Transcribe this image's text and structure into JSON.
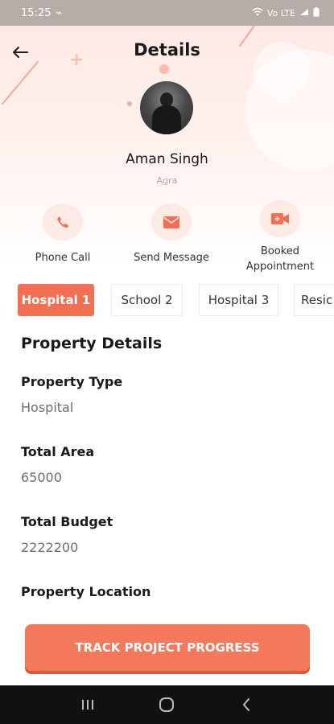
{
  "status_bar": {
    "time": "15:25",
    "signal": "Vo LTE",
    "battery": "▮"
  },
  "header": {
    "title": "Details"
  },
  "profile": {
    "name": "Aman Singh",
    "city": "Agra"
  },
  "actions": [
    {
      "label": "Phone Call",
      "icon": "phone-icon"
    },
    {
      "label": "Send Message",
      "icon": "mail-icon"
    },
    {
      "label": "Booked Appointment",
      "icon": "video-call-icon"
    }
  ],
  "tabs": [
    "Hospital 1",
    "School 2",
    "Hospital 3",
    "Resic"
  ],
  "active_tab": "Hospital 1",
  "details": {
    "section_title": "Property Details",
    "fields": [
      {
        "label": "Property Type",
        "value": "Hospital"
      },
      {
        "label": "Total Area",
        "value": "65000"
      },
      {
        "label": "Total Budget",
        "value": "2222200"
      },
      {
        "label": "Property Location",
        "value": ""
      }
    ]
  },
  "cta": {
    "label": "TRACK PROJECT PROGRESS"
  },
  "colors": {
    "accent": "#f26f53",
    "accent_light": "#fdeae5",
    "header_bg": "#fde9e4"
  }
}
